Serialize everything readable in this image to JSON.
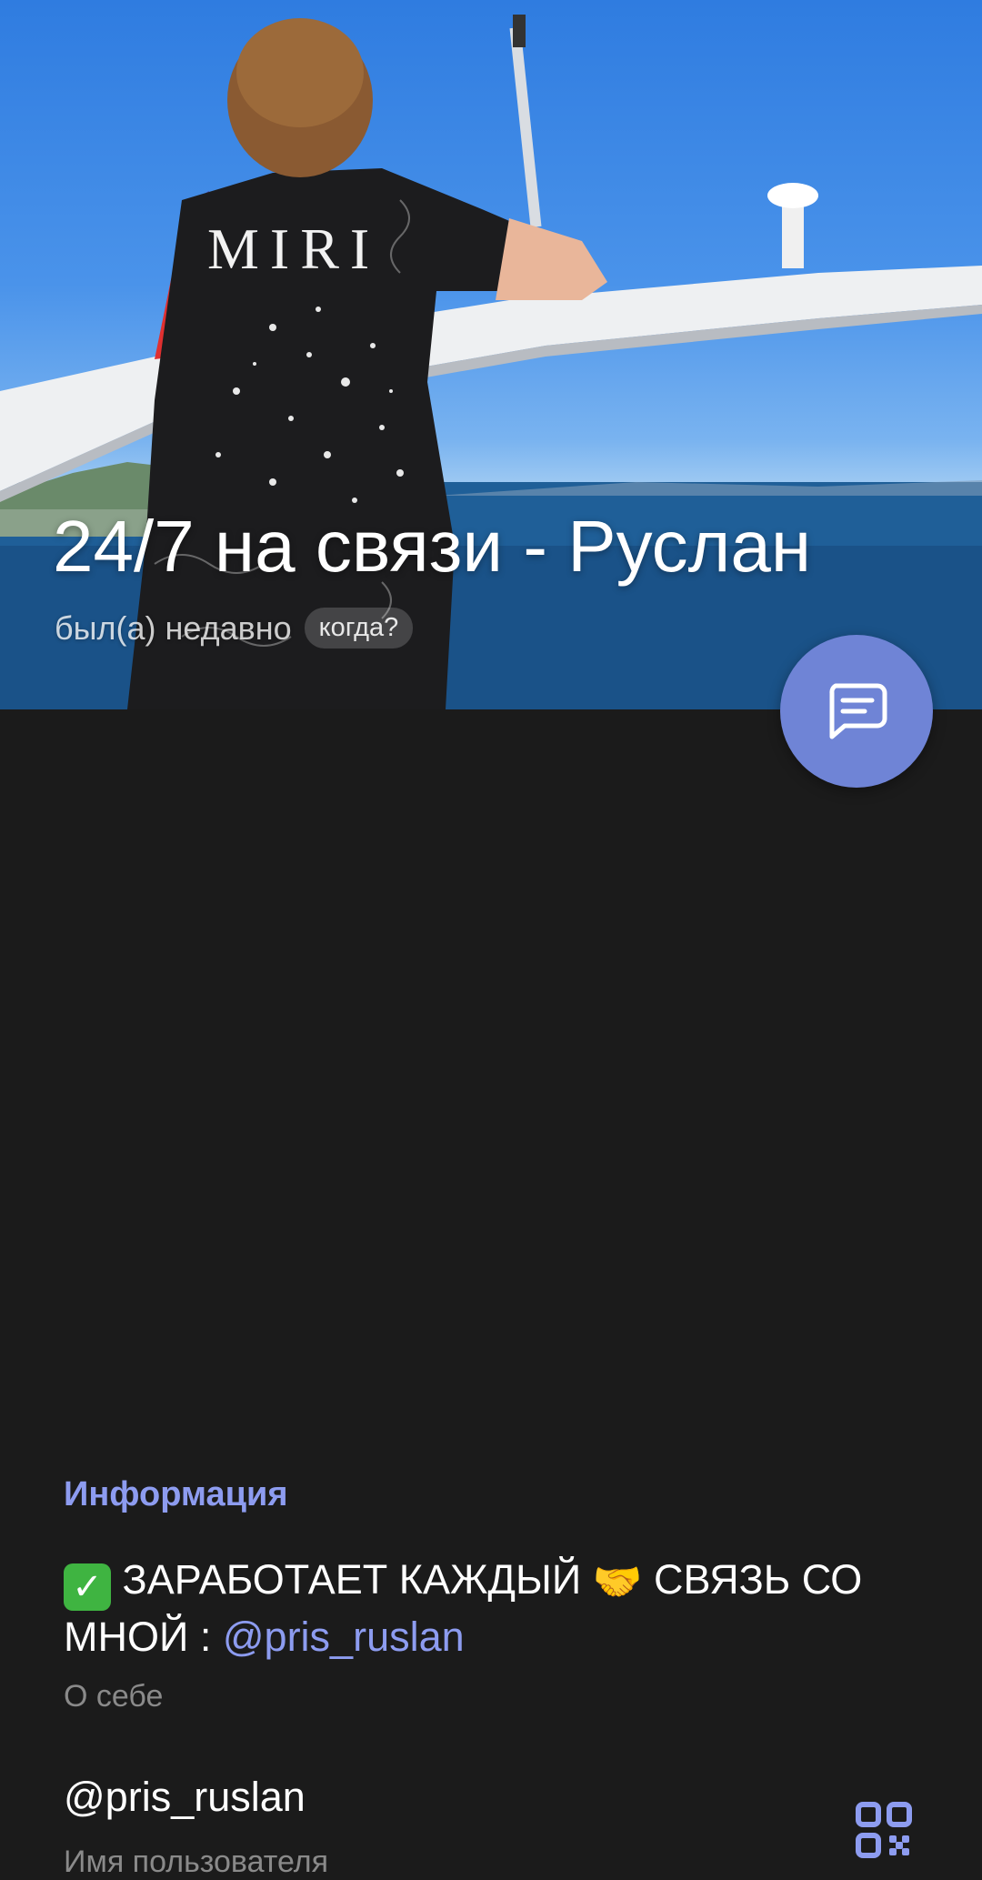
{
  "profile": {
    "name": "24/7 на связи - Руслан",
    "status": "был(а) недавно",
    "when_chip": "когда?"
  },
  "info": {
    "section_title": "Информация",
    "bio_prefix": "ЗАРАБОТАЕТ КАЖДЫЙ",
    "bio_middle": "СВЯЗЬ СО МНОЙ :",
    "bio_mention": "@pris_ruslan",
    "bio_caption": "О себе",
    "username": "@pris_ruslan",
    "username_caption": "Имя пользователя",
    "icons": [
      "check-mark-icon",
      "handshake-icon",
      "qr-code-icon",
      "chat-icon"
    ]
  },
  "photo": {
    "shirt_text": "MIRI"
  },
  "colors": {
    "accent": "#8d9cf0",
    "fab": "#6f84d6",
    "background": "#1b1b1b"
  }
}
